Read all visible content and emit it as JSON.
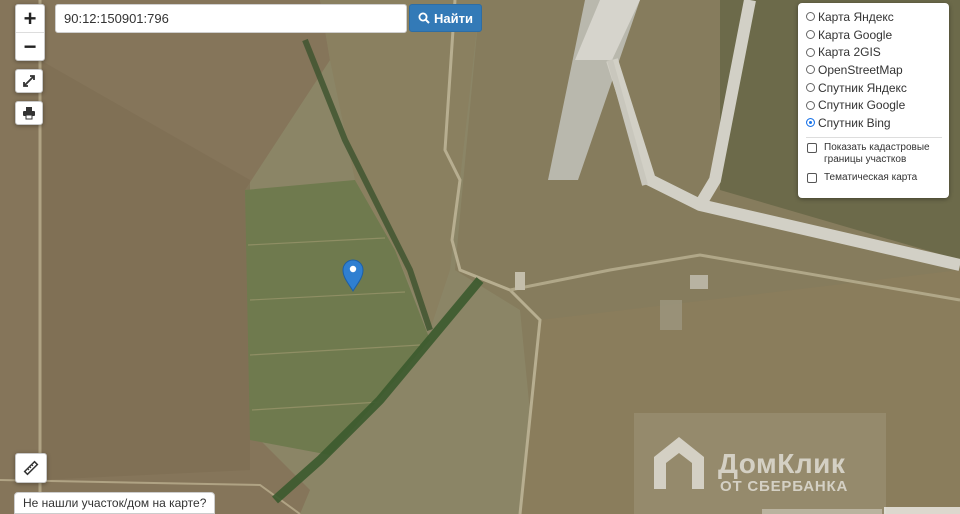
{
  "search": {
    "value": "90:12:150901:796"
  },
  "find_button": {
    "label": "Найти"
  },
  "zoom": {
    "in": "+",
    "out": "−"
  },
  "layers": [
    {
      "label": "Карта Яндекс",
      "selected": false
    },
    {
      "label": "Карта Google",
      "selected": false
    },
    {
      "label": "Карта 2GIS",
      "selected": false
    },
    {
      "label": "OpenStreetMap",
      "selected": false
    },
    {
      "label": "Спутник Яндекс",
      "selected": false
    },
    {
      "label": "Спутник Google",
      "selected": false
    },
    {
      "label": "Спутник Bing",
      "selected": true
    }
  ],
  "overlays": [
    {
      "label": "Показать кадастровые границы участков",
      "checked": false
    },
    {
      "label": "Тематическая карта",
      "checked": false
    }
  ],
  "not_found_link": "Не нашли участок/дом на карте?",
  "watermark": {
    "title": "ДомКлик",
    "subtitle": "ОТ СБЕРБАНКА"
  },
  "colors": {
    "marker": "#2f7fd1",
    "accent": "#337ab7",
    "selected_radio": "#1a73e8"
  },
  "icons": {
    "search": "search-icon",
    "fullscreen": "fullscreen-icon",
    "print": "printer-icon",
    "ruler": "ruler-icon",
    "marker": "location-pin-icon"
  }
}
